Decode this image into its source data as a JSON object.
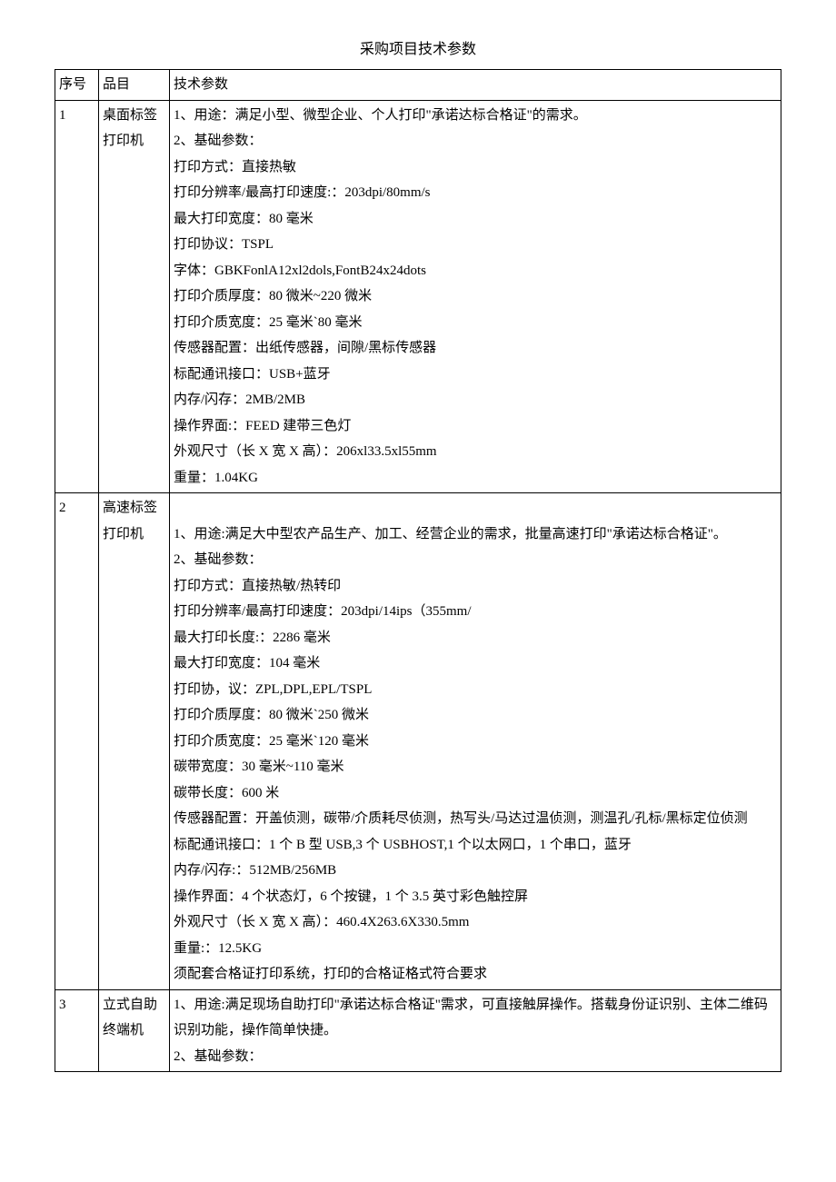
{
  "title": "采购项目技术参数",
  "headers": {
    "seq": "序号",
    "item": "品目",
    "tech": "技术参数"
  },
  "rows": [
    {
      "seq": "1",
      "item": "桌面标签打印机",
      "tech": "1、用途：满足小型、微型企业、个人打印\"承诺达标合格证\"的需求。\n2、基础参数：\n打印方式：直接热敏\n打印分辨率/最高打印速度:：203dpi/80mm/s\n最大打印宽度：80 毫米\n打印协议：TSPL\n字体：GBKFonlA12xl2dols,FontB24x24dots\n打印介质厚度：80 微米~220 微米\n打印介质宽度：25 毫米`80 毫米\n传感器配置：出纸传感器，间隙/黑标传感器\n标配通讯接口：USB+蓝牙\n内存/闪存：2MB/2MB\n操作界面:：FEED 建带三色灯\n外观尺寸（长 X 宽 X 高）：206xl33.5xl55mm\n重量：1.04KG"
    },
    {
      "seq": "2",
      "item": "高速标签打印机",
      "tech": "\n1、用途:满足大中型农产品生产、加工、经营企业的需求，批量高速打印\"承诺达标合格证\"。\n2、基础参数：\n打印方式：直接热敏/热转印\n打印分辨率/最高打印速度：203dpi/14ips（355mm/\n最大打印长度:：2286 毫米\n最大打印宽度：104 毫米\n打印协，议：ZPL,DPL,EPL/TSPL\n打印介质厚度：80 微米`250 微米\n打印介质宽度：25 毫米`120 毫米\n碳带宽度：30 毫米~110 毫米\n碳带长度：600 米\n传感器配置：开盖侦测，碳带/介质耗尽侦测，热写头/马达过温侦测，测温孔/孔标/黑标定位侦测\n标配通讯接口：1 个 B 型 USB,3 个 USBHOST,1 个以太网口，1 个串口，蓝牙\n内存/闪存:：512MB/256MB\n操作界面：4 个状态灯，6 个按键，1 个 3.5 英寸彩色触控屏\n外观尺寸（长 X 宽 X 高）：460.4X263.6X330.5mm\n重量:：12.5KG\n须配套合格证打印系统，打印的合格证格式符合要求"
    },
    {
      "seq": "3",
      "item": "立式自助终端机",
      "tech": "1、用途:满足现场自助打印\"承诺达标合格证\"需求，可直接触屏操作。搭载身份证识别、主体二维码识别功能，操作简单快捷。\n2、基础参数："
    }
  ]
}
